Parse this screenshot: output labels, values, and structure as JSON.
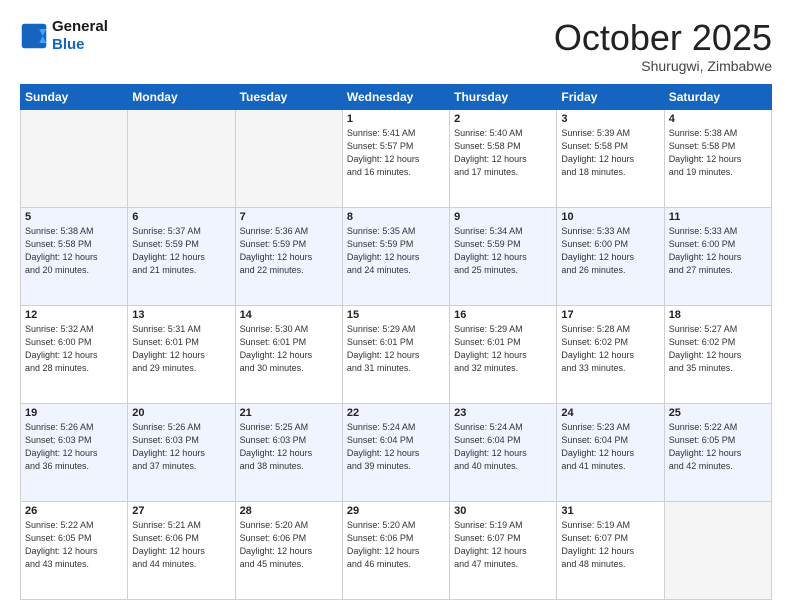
{
  "header": {
    "logo_line1": "General",
    "logo_line2": "Blue",
    "month": "October 2025",
    "location": "Shurugwi, Zimbabwe"
  },
  "days_of_week": [
    "Sunday",
    "Monday",
    "Tuesday",
    "Wednesday",
    "Thursday",
    "Friday",
    "Saturday"
  ],
  "weeks": [
    {
      "days": [
        {
          "num": "",
          "info": ""
        },
        {
          "num": "",
          "info": ""
        },
        {
          "num": "",
          "info": ""
        },
        {
          "num": "1",
          "info": "Sunrise: 5:41 AM\nSunset: 5:57 PM\nDaylight: 12 hours\nand 16 minutes."
        },
        {
          "num": "2",
          "info": "Sunrise: 5:40 AM\nSunset: 5:58 PM\nDaylight: 12 hours\nand 17 minutes."
        },
        {
          "num": "3",
          "info": "Sunrise: 5:39 AM\nSunset: 5:58 PM\nDaylight: 12 hours\nand 18 minutes."
        },
        {
          "num": "4",
          "info": "Sunrise: 5:38 AM\nSunset: 5:58 PM\nDaylight: 12 hours\nand 19 minutes."
        }
      ]
    },
    {
      "days": [
        {
          "num": "5",
          "info": "Sunrise: 5:38 AM\nSunset: 5:58 PM\nDaylight: 12 hours\nand 20 minutes."
        },
        {
          "num": "6",
          "info": "Sunrise: 5:37 AM\nSunset: 5:59 PM\nDaylight: 12 hours\nand 21 minutes."
        },
        {
          "num": "7",
          "info": "Sunrise: 5:36 AM\nSunset: 5:59 PM\nDaylight: 12 hours\nand 22 minutes."
        },
        {
          "num": "8",
          "info": "Sunrise: 5:35 AM\nSunset: 5:59 PM\nDaylight: 12 hours\nand 24 minutes."
        },
        {
          "num": "9",
          "info": "Sunrise: 5:34 AM\nSunset: 5:59 PM\nDaylight: 12 hours\nand 25 minutes."
        },
        {
          "num": "10",
          "info": "Sunrise: 5:33 AM\nSunset: 6:00 PM\nDaylight: 12 hours\nand 26 minutes."
        },
        {
          "num": "11",
          "info": "Sunrise: 5:33 AM\nSunset: 6:00 PM\nDaylight: 12 hours\nand 27 minutes."
        }
      ]
    },
    {
      "days": [
        {
          "num": "12",
          "info": "Sunrise: 5:32 AM\nSunset: 6:00 PM\nDaylight: 12 hours\nand 28 minutes."
        },
        {
          "num": "13",
          "info": "Sunrise: 5:31 AM\nSunset: 6:01 PM\nDaylight: 12 hours\nand 29 minutes."
        },
        {
          "num": "14",
          "info": "Sunrise: 5:30 AM\nSunset: 6:01 PM\nDaylight: 12 hours\nand 30 minutes."
        },
        {
          "num": "15",
          "info": "Sunrise: 5:29 AM\nSunset: 6:01 PM\nDaylight: 12 hours\nand 31 minutes."
        },
        {
          "num": "16",
          "info": "Sunrise: 5:29 AM\nSunset: 6:01 PM\nDaylight: 12 hours\nand 32 minutes."
        },
        {
          "num": "17",
          "info": "Sunrise: 5:28 AM\nSunset: 6:02 PM\nDaylight: 12 hours\nand 33 minutes."
        },
        {
          "num": "18",
          "info": "Sunrise: 5:27 AM\nSunset: 6:02 PM\nDaylight: 12 hours\nand 35 minutes."
        }
      ]
    },
    {
      "days": [
        {
          "num": "19",
          "info": "Sunrise: 5:26 AM\nSunset: 6:03 PM\nDaylight: 12 hours\nand 36 minutes."
        },
        {
          "num": "20",
          "info": "Sunrise: 5:26 AM\nSunset: 6:03 PM\nDaylight: 12 hours\nand 37 minutes."
        },
        {
          "num": "21",
          "info": "Sunrise: 5:25 AM\nSunset: 6:03 PM\nDaylight: 12 hours\nand 38 minutes."
        },
        {
          "num": "22",
          "info": "Sunrise: 5:24 AM\nSunset: 6:04 PM\nDaylight: 12 hours\nand 39 minutes."
        },
        {
          "num": "23",
          "info": "Sunrise: 5:24 AM\nSunset: 6:04 PM\nDaylight: 12 hours\nand 40 minutes."
        },
        {
          "num": "24",
          "info": "Sunrise: 5:23 AM\nSunset: 6:04 PM\nDaylight: 12 hours\nand 41 minutes."
        },
        {
          "num": "25",
          "info": "Sunrise: 5:22 AM\nSunset: 6:05 PM\nDaylight: 12 hours\nand 42 minutes."
        }
      ]
    },
    {
      "days": [
        {
          "num": "26",
          "info": "Sunrise: 5:22 AM\nSunset: 6:05 PM\nDaylight: 12 hours\nand 43 minutes."
        },
        {
          "num": "27",
          "info": "Sunrise: 5:21 AM\nSunset: 6:06 PM\nDaylight: 12 hours\nand 44 minutes."
        },
        {
          "num": "28",
          "info": "Sunrise: 5:20 AM\nSunset: 6:06 PM\nDaylight: 12 hours\nand 45 minutes."
        },
        {
          "num": "29",
          "info": "Sunrise: 5:20 AM\nSunset: 6:06 PM\nDaylight: 12 hours\nand 46 minutes."
        },
        {
          "num": "30",
          "info": "Sunrise: 5:19 AM\nSunset: 6:07 PM\nDaylight: 12 hours\nand 47 minutes."
        },
        {
          "num": "31",
          "info": "Sunrise: 5:19 AM\nSunset: 6:07 PM\nDaylight: 12 hours\nand 48 minutes."
        },
        {
          "num": "",
          "info": ""
        }
      ]
    }
  ]
}
